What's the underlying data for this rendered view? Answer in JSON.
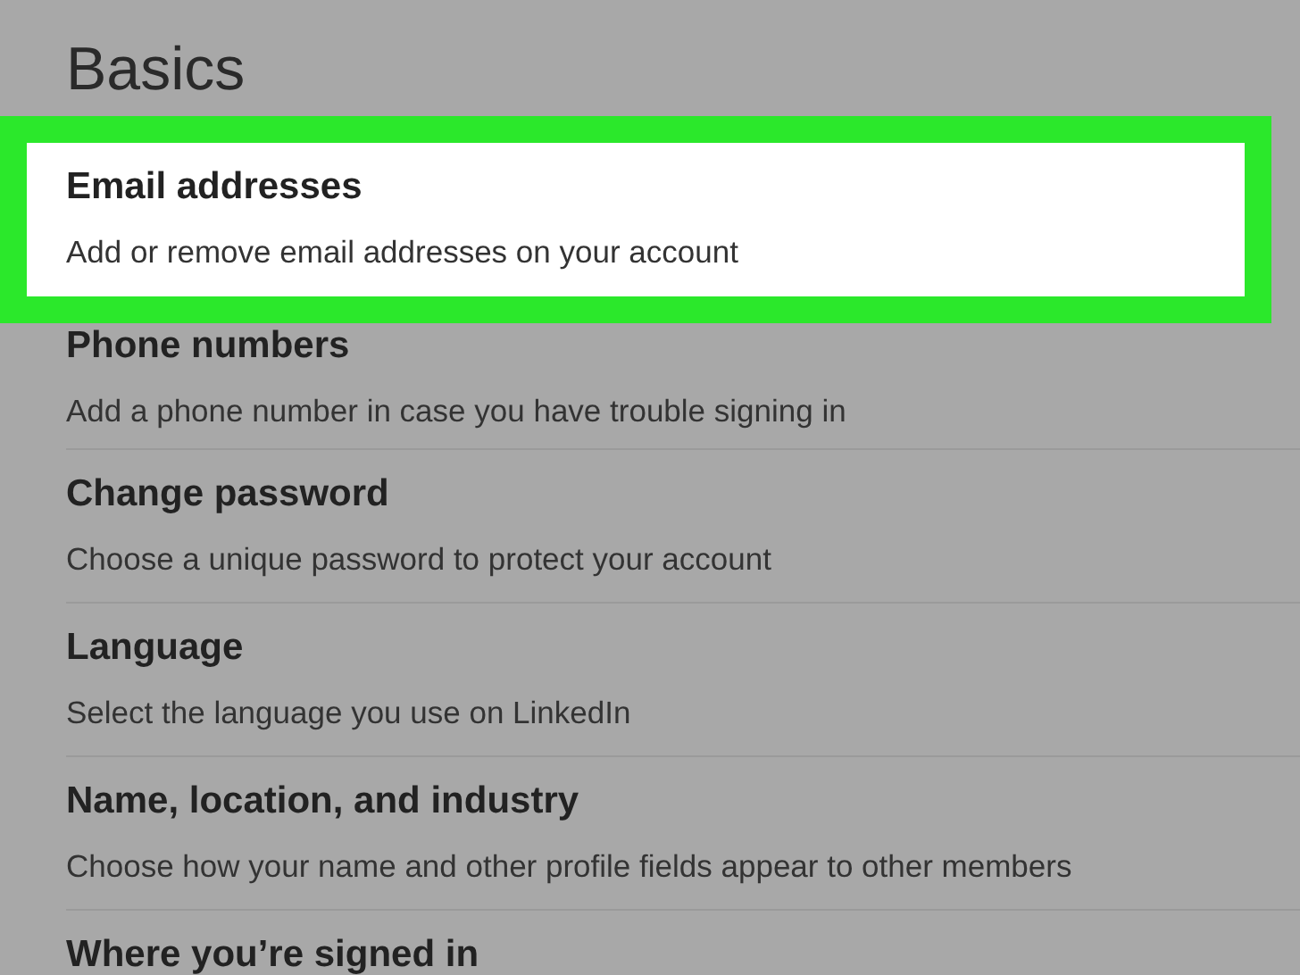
{
  "section": {
    "title": "Basics"
  },
  "items": [
    {
      "title": "Email addresses",
      "description": "Add or remove email addresses on your account",
      "highlighted": true
    },
    {
      "title": "Phone numbers",
      "description": "Add a phone number in case you have trouble signing in",
      "highlighted": false
    },
    {
      "title": "Change password",
      "description": "Choose a unique password to protect your account",
      "highlighted": false
    },
    {
      "title": "Language",
      "description": "Select the language you use on LinkedIn",
      "highlighted": false
    },
    {
      "title": "Name, location, and industry",
      "description": "Choose how your name and other profile fields appear to other members",
      "highlighted": false
    },
    {
      "title": "Where you’re signed in",
      "highlighted": false
    }
  ]
}
